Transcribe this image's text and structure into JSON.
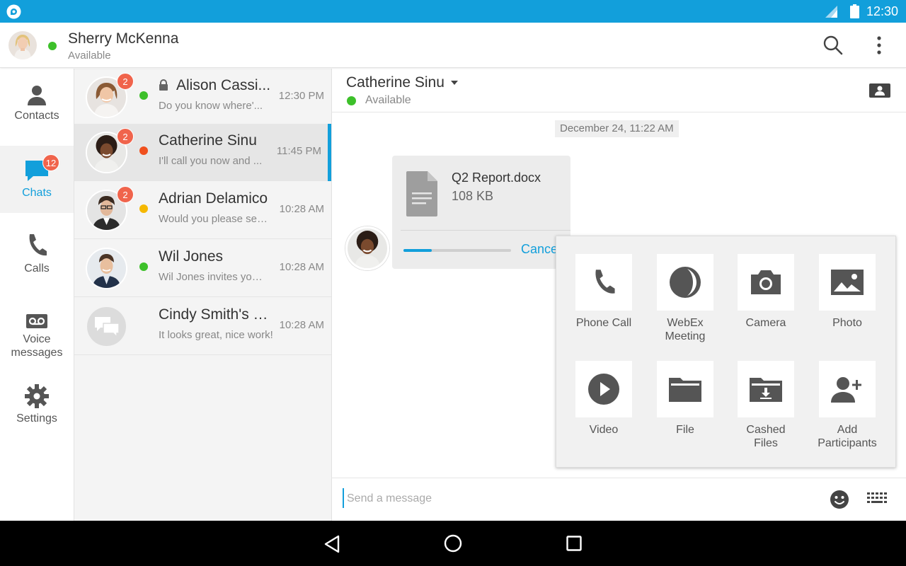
{
  "status_bar": {
    "time": "12:30"
  },
  "user": {
    "name": "Sherry McKenna",
    "status": "Available",
    "presence_color": "#3dc02a"
  },
  "header": {
    "search_icon": "search-icon",
    "more_icon": "more-vert-icon"
  },
  "nav": {
    "items": [
      {
        "label": "Contacts",
        "icon": "person-icon",
        "badge": ""
      },
      {
        "label": "Chats",
        "icon": "chat-bubble-icon",
        "badge": "12",
        "active": true
      },
      {
        "label": "Calls",
        "icon": "phone-icon",
        "badge": ""
      },
      {
        "label": "Voice messages",
        "icon": "voicemail-icon",
        "badge": ""
      },
      {
        "label": "Settings",
        "icon": "gear-icon",
        "badge": ""
      }
    ]
  },
  "chats": [
    {
      "name": "Alison Cassi...",
      "preview": "Do you know where'...",
      "time": "12:30 PM",
      "badge": "2",
      "presence_color": "#3dc02a",
      "locked": true
    },
    {
      "name": "Catherine Sinu",
      "preview": "I'll call you now and ...",
      "time": "11:45 PM",
      "badge": "2",
      "presence_color": "#f0501e",
      "selected": true
    },
    {
      "name": "Adrian Delamico",
      "preview": "Would you please sen...",
      "time": "10:28 AM",
      "badge": "2",
      "presence_color": "#f5b800"
    },
    {
      "name": "Wil Jones",
      "preview": "Wil Jones invites you ...",
      "time": "10:28 AM",
      "badge": "",
      "presence_color": "#3dc02a"
    },
    {
      "name": "Cindy Smith's G...",
      "preview": "It looks great, nice work!",
      "time": "10:28 AM",
      "badge": "",
      "group": true
    }
  ],
  "conversation": {
    "name": "Catherine Sinu",
    "status": "Available",
    "date_chip": "December 24, 11:22 AM",
    "file": {
      "name": "Q2 Report.docx",
      "size": "108 KB",
      "progress": 0.26,
      "cancel_label": "Cancel"
    },
    "composer_placeholder": "Send a message"
  },
  "attach_menu": [
    {
      "label": "Phone Call",
      "icon": "phone-icon"
    },
    {
      "label": "WebEx Meeting",
      "icon": "webex-icon"
    },
    {
      "label": "Camera",
      "icon": "camera-icon"
    },
    {
      "label": "Photo",
      "icon": "photo-icon"
    },
    {
      "label": "Video",
      "icon": "play-icon"
    },
    {
      "label": "File",
      "icon": "folder-icon"
    },
    {
      "label": "Cashed Files",
      "icon": "download-folder-icon"
    },
    {
      "label": "Add Participants",
      "icon": "add-person-icon"
    }
  ],
  "colors": {
    "accent": "#129fdb",
    "badge": "#f0644c"
  }
}
